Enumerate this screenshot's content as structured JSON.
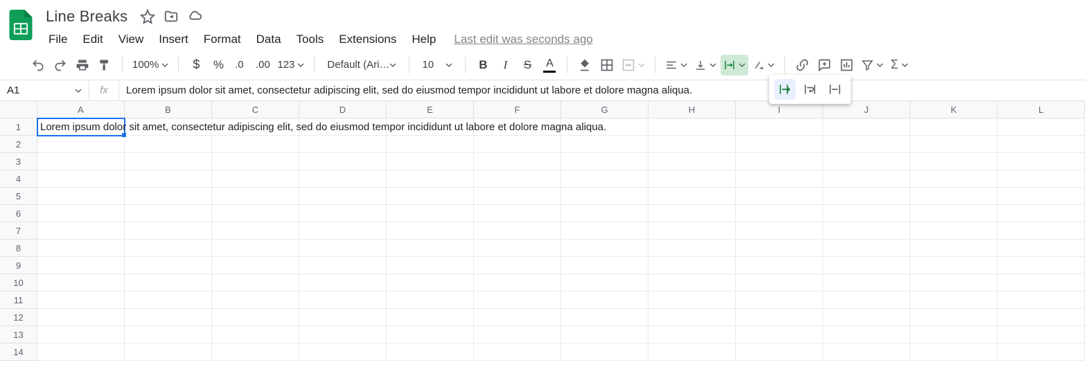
{
  "doc": {
    "title": "Line Breaks"
  },
  "menus": [
    "File",
    "Edit",
    "View",
    "Insert",
    "Format",
    "Data",
    "Tools",
    "Extensions",
    "Help"
  ],
  "last_edit": "Last edit was seconds ago",
  "toolbar": {
    "zoom": "100%",
    "font": "Default (Ari…",
    "font_size": "10",
    "number": "123"
  },
  "name_box": "A1",
  "fx": "fx",
  "formula": "Lorem ipsum dolor sit amet, consectetur adipiscing elit, sed do eiusmod tempor incididunt ut labore et dolore magna aliqua.",
  "columns": [
    "A",
    "B",
    "C",
    "D",
    "E",
    "F",
    "G",
    "H",
    "I",
    "J",
    "K",
    "L"
  ],
  "rows": [
    "1",
    "2",
    "3",
    "4",
    "5",
    "6",
    "7",
    "8",
    "9",
    "10",
    "11",
    "12",
    "13",
    "14"
  ],
  "cell_A1": "Lorem ipsum dolor sit amet, consectetur adipiscing elit, sed do eiusmod tempor incididunt ut labore et dolore magna aliqua."
}
